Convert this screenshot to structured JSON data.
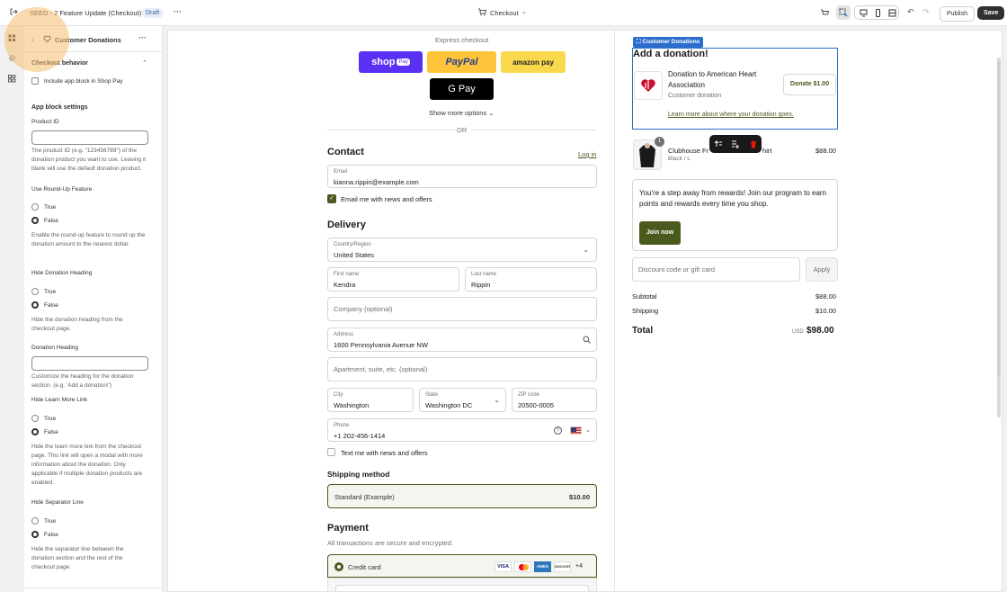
{
  "topbar": {
    "title": "SEED - 2 Feature Update (Checkout)",
    "badge": "Draft",
    "more": "···",
    "page_select": "Checkout",
    "publish": "Publish",
    "save": "Save"
  },
  "panel": {
    "title": "Customer Donations",
    "checkout_behavior": "Checkout behavior",
    "include_app_block": "Include app block in Shop Pay",
    "app_block_settings": "App block settings",
    "product_id_label": "Product ID",
    "product_id_help": "The product ID (e.g. \"123456789\") of the donation product you want to use. Leaving it blank will use the default donation product.",
    "round_up_label": "Use Round-Up Feature",
    "true_label": "True",
    "false_label": "False",
    "round_up_help": "Enable the round-up feature to round up the donation amount to the nearest dollar.",
    "hide_heading_label": "Hide Donation Heading",
    "hide_heading_help": "Hide the donation heading from the checkout page.",
    "donation_heading_label": "Donation Heading",
    "donation_heading_help": "Customize the heading for the donation section. (e.g. 'Add a donation!')",
    "hide_learn_more_label": "Hide Learn More Link",
    "hide_learn_more_help": "Hide the learn more link from the checkout page. This link will open a modal with more information about the donation. Only applicable if multiple donation products are enabled.",
    "hide_separator_label": "Hide Separator Line",
    "hide_separator_help": "Hide the separator line between the donation section and the rest of the checkout page."
  },
  "checkout": {
    "express": "Express checkout",
    "shop_pay": "shop",
    "shop_pay_suffix": "Pay",
    "paypal": "PayPal",
    "amazon_pay": "amazon pay",
    "gpay": "G Pay",
    "show_more": "Show more options",
    "or": "OR",
    "contact": "Contact",
    "login": "Log in",
    "email_label": "Email",
    "email_value": "kianna.rippin@example.com",
    "email_news": "Email me with news and offers",
    "delivery": "Delivery",
    "country_label": "Country/Region",
    "country_value": "United States",
    "first_name_label": "First name",
    "first_name_value": "Kendra",
    "last_name_label": "Last name",
    "last_name_value": "Rippin",
    "company_placeholder": "Company (optional)",
    "address_label": "Address",
    "address_value": "1600 Pennsylvania Avenue NW",
    "apartment_placeholder": "Apartment, suite, etc. (optional)",
    "city_label": "City",
    "city_value": "Washington",
    "state_label": "State",
    "state_value": "Washington DC",
    "zip_label": "ZIP code",
    "zip_value": "20500-0005",
    "phone_label": "Phone",
    "phone_value": "+1 202-456-1414",
    "text_news": "Text me with news and offers",
    "shipping_method": "Shipping method",
    "shipping_option": "Standard (Example)",
    "shipping_price": "$10.00",
    "payment": "Payment",
    "payment_sub": "All transactions are secure and encrypted.",
    "credit_card": "Credit card",
    "card_visa": "VISA",
    "card_amex": "AMEX",
    "card_discover": "DISCOVER",
    "card_more": "+4"
  },
  "summary": {
    "block_tag": "Customer Donations",
    "add_donation": "Add a donation!",
    "donation_title": "Donation to American Heart Association",
    "donation_sub": "Customer donation",
    "donate_button": "Donate $1.00",
    "learn_more": "Learn more about where your donation goes.",
    "product_qty": "1",
    "product_name": "Clubhouse Fr",
    "product_name_end": "hirt",
    "product_variant": "Black / L",
    "product_price": "$88.00",
    "rewards_text": "You're a step away from rewards! Join our program to earn points and rewards every time you shop.",
    "join_now": "Join now",
    "discount_placeholder": "Discount code or gift card",
    "apply": "Apply",
    "subtotal_label": "Subtotal",
    "subtotal_value": "$88.00",
    "shipping_label": "Shipping",
    "shipping_value": "$10.00",
    "total_label": "Total",
    "total_currency": "USD",
    "total_value": "$98.00"
  },
  "colors": {
    "accent_blue": "#2c6ecb",
    "shop_pay": "#5a31f4",
    "paypal": "#ffc439",
    "amazon": "#f9d84e",
    "join_button": "#4a5a1e",
    "checkbox_green": "#4a5a1e",
    "delete_red": "#e51c00"
  }
}
